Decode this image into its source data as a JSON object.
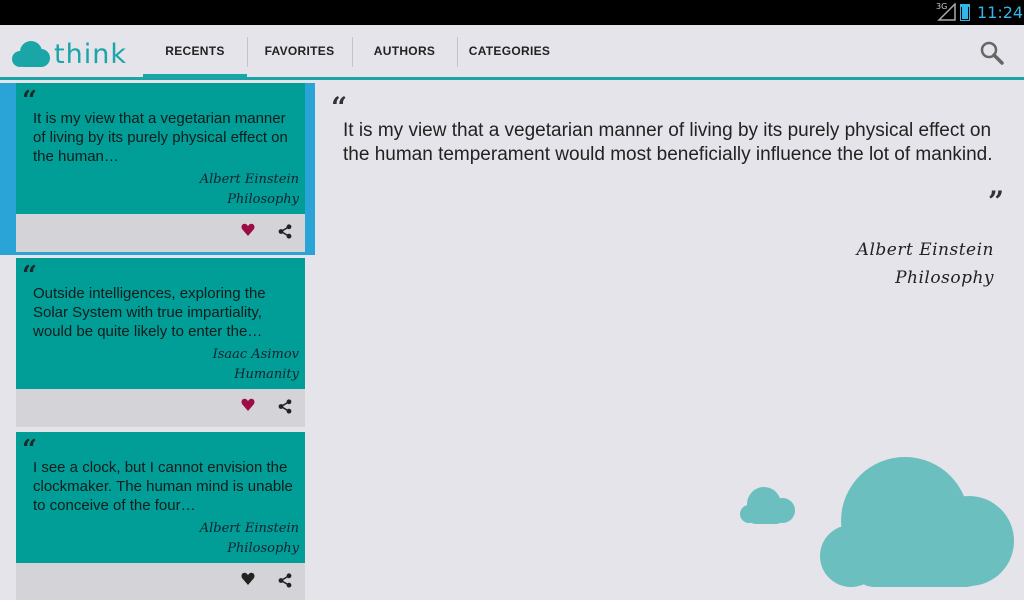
{
  "status_bar": {
    "network": "3G",
    "time": "11:24"
  },
  "app": {
    "logo_text": "think"
  },
  "tabs": [
    {
      "label": "RECENTS",
      "active": true
    },
    {
      "label": "FAVORITES",
      "active": false
    },
    {
      "label": "AUTHORS",
      "active": false
    },
    {
      "label": "CATEGORIES",
      "active": false
    }
  ],
  "quotes": [
    {
      "text": "It is my view that a vegetarian manner of living by its purely physical effect on the human…",
      "author": "Albert Einstein",
      "category": "Philosophy",
      "favorite": true,
      "selected": true
    },
    {
      "text": "Outside intelligences, exploring the Solar System with true impartiality, would be quite likely to enter the…",
      "author": "Isaac Asimov",
      "category": "Humanity",
      "favorite": true,
      "selected": false
    },
    {
      "text": "I see a clock, but I cannot envision the clockmaker. The human mind is unable to conceive of the four…",
      "author": "Albert Einstein",
      "category": "Philosophy",
      "favorite": false,
      "selected": false
    }
  ],
  "detail": {
    "text": "It is my view that a vegetarian manner of living by its purely physical effect on the human temperament would most beneficially influence the lot of mankind.",
    "author": "Albert Einstein",
    "category": "Philosophy"
  },
  "icons": {
    "search": "search-icon",
    "favorite": "heart-icon",
    "share": "share-icon",
    "quote_open": "quote-open-icon",
    "quote_close": "quote-close-icon"
  },
  "colors": {
    "accent": "#1aa5a7",
    "card": "#009e96",
    "selected": "#2aa3d6",
    "heart_on": "#9c0d48",
    "heart_off": "#222222",
    "cloud": "#6bbfbf"
  }
}
